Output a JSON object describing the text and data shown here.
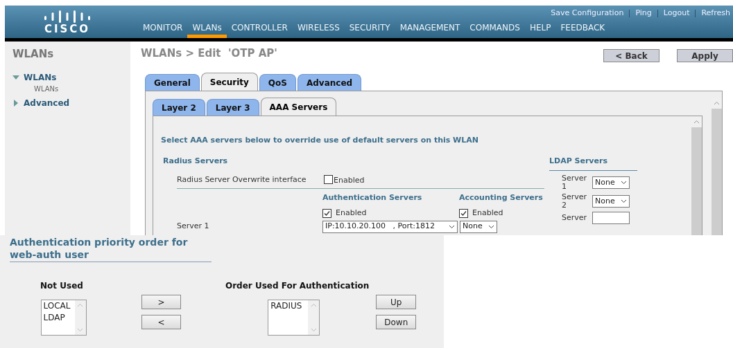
{
  "header": {
    "logo": "CISCO",
    "top_links": [
      {
        "label": "Save Configuration"
      },
      {
        "label": "Ping"
      },
      {
        "label": "Logout"
      },
      {
        "label": "Refresh"
      }
    ],
    "nav": [
      {
        "label": "MONITOR",
        "selected": false
      },
      {
        "label": "WLANs",
        "selected": true
      },
      {
        "label": "CONTROLLER",
        "selected": false
      },
      {
        "label": "WIRELESS",
        "selected": false
      },
      {
        "label": "SECURITY",
        "selected": false
      },
      {
        "label": "MANAGEMENT",
        "selected": false
      },
      {
        "label": "COMMANDS",
        "selected": false
      },
      {
        "label": "HELP",
        "selected": false
      },
      {
        "label": "FEEDBACK",
        "selected": false
      }
    ]
  },
  "sidebar": {
    "title": "WLANs",
    "items": [
      {
        "label": "WLANs",
        "expanded": true,
        "children": [
          {
            "label": "WLANs"
          }
        ]
      },
      {
        "label": "Advanced",
        "expanded": false
      }
    ]
  },
  "page": {
    "title": "WLANs > Edit  'OTP AP'",
    "buttons": [
      "< Back",
      "Apply"
    ],
    "tabs": [
      {
        "label": "General",
        "selected": false
      },
      {
        "label": "Security",
        "selected": true
      },
      {
        "label": "QoS",
        "selected": false
      },
      {
        "label": "Advanced",
        "selected": false
      }
    ],
    "subtabs": [
      {
        "label": "Layer 2",
        "selected": false
      },
      {
        "label": "Layer 3",
        "selected": false
      },
      {
        "label": "AAA Servers",
        "selected": true
      }
    ],
    "intro": "Select AAA servers below to override use of default servers on this WLAN",
    "radius_heading": "Radius Servers",
    "overwrite": {
      "label": "Radius Server Overwrite interface",
      "checkbox_label": "Enabled",
      "checked": false
    },
    "auth_heading": "Authentication Servers",
    "acct_heading": "Accounting Servers",
    "auth_enabled": {
      "label": "Enabled",
      "checked": true
    },
    "acct_enabled": {
      "label": "Enabled",
      "checked": true
    },
    "server_rows": [
      {
        "label": "Server 1",
        "auth_value": "IP:10.10.20.100   , Port:1812",
        "acct_value": "None"
      }
    ],
    "ldap_heading": "LDAP Servers",
    "ldap_servers": [
      {
        "label": "Server 1",
        "value": "None"
      },
      {
        "label": "Server 2",
        "value": "None"
      },
      {
        "label": "Server"
      }
    ]
  },
  "priority": {
    "heading": "Authentication priority order for web-auth user",
    "not_used": {
      "heading": "Not Used",
      "items": [
        "LOCAL",
        "LDAP"
      ]
    },
    "move_buttons": [
      ">",
      "<"
    ],
    "used": {
      "heading": "Order Used For Authentication",
      "items": [
        "RADIUS"
      ]
    },
    "order_buttons": [
      "Up",
      "Down"
    ]
  }
}
